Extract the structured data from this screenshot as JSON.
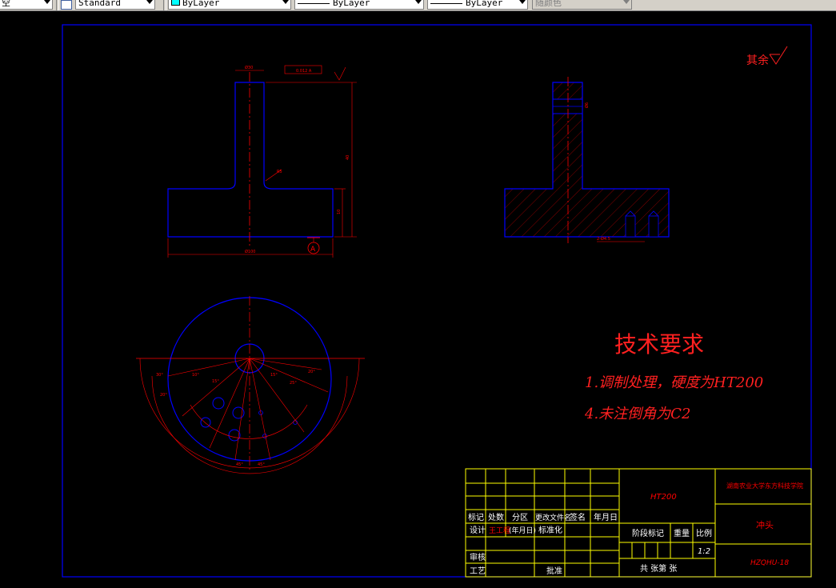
{
  "toolbar": {
    "layer_value": "空",
    "textstyle_value": "Standard",
    "color_value": "ByLayer",
    "linetype_value": "ByLayer",
    "lineweight_value": "ByLayer",
    "plotstyle_value": "随颜色"
  },
  "drawing": {
    "roughness_note": "其余",
    "dims": {
      "top_width": "Ø30",
      "tolerance": "0.012 A",
      "height_total": "40",
      "base_height": "10",
      "base_width": "Ø100",
      "radius": "R5",
      "datum": "A",
      "hole_dim": "2-Ø4.5",
      "section_dim": "Ø6",
      "angles": [
        "30°",
        "20°",
        "10°",
        "15°",
        "15°",
        "25°",
        "20°",
        "45°",
        "45°"
      ]
    },
    "tech_title": "技术要求",
    "tech_line1": "1.调制处理，硬度为HT200",
    "tech_line2": "4.未注倒角为C2"
  },
  "title_block": {
    "material": "HT200",
    "school": "湖南农业大学东方科技学院",
    "part_name": "冲头",
    "drawing_no": "HZQHU-18",
    "scale": "1:2",
    "h_biaoji": "标记",
    "h_chushu": "处数",
    "h_fenqu": "分区",
    "h_gaiwen": "更改文件名",
    "h_qianming": "签名",
    "h_nianyueri": "年月日",
    "r_sheji": "设计",
    "sheji_name": "王工程",
    "r_nianyueri2": "(年月日)",
    "r_biaozhunhua": "标准化",
    "r_shenhe": "审核",
    "r_gongyi": "工艺",
    "r_pizhun": "批准",
    "stage_label": "阶段标记",
    "weight_label": "重量",
    "scale_label": "比例",
    "sheets": "共 张第 张"
  }
}
